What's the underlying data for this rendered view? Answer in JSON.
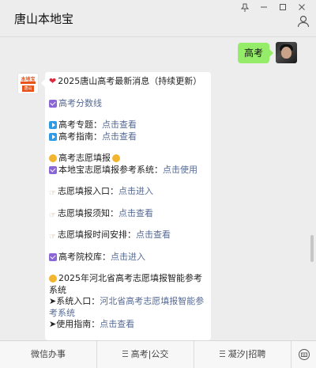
{
  "window": {
    "title": "唐山本地宝",
    "controls": {
      "pin": "⊥",
      "minimize": "–",
      "maximize": "□",
      "close": "✕"
    }
  },
  "outgoing": {
    "text": "高考"
  },
  "bot": {
    "avatar_text_top": "本地宝",
    "avatar_text_bottom": "唐山",
    "lines": [
      {
        "icon": "heart-icon",
        "text": "2025唐山高考最新消息（持续更新）"
      },
      {
        "icon": "check-icon",
        "link": "高考分数线"
      },
      {
        "icon": "play-icon",
        "prefix": "高考专题：",
        "link": "点击查看"
      },
      {
        "icon": "play-icon",
        "prefix": "高考指南：",
        "link": "点击查看"
      },
      {
        "icon": "dot-icon",
        "text": "高考志愿填报",
        "trail_icon": "dot-icon"
      },
      {
        "icon": "check-icon",
        "prefix": "本地宝志愿填报参考系统：",
        "link": "点击使用"
      },
      {
        "icon": "hand-icon",
        "prefix": "志愿填报入口：",
        "link": "点击进入"
      },
      {
        "icon": "hand-icon",
        "prefix": "志愿填报须知：",
        "link": "点击查看"
      },
      {
        "icon": "hand-icon",
        "prefix": "志愿填报时间安排：",
        "link": "点击查看"
      },
      {
        "icon": "check-icon",
        "prefix": "高考院校库：",
        "link": "点击进入"
      },
      {
        "icon": "dot-icon",
        "text": "2025年河北省高考志愿填报智能参考系统"
      },
      {
        "icon": "arrow-icon",
        "prefix": "➤系统入口：",
        "link": "河北省高考志愿填报智能参考系统"
      },
      {
        "icon": "arrow-icon",
        "prefix": "➤使用指南：",
        "link": "点击查看"
      }
    ]
  },
  "menu": {
    "items": [
      "微信办事",
      "高考|公交",
      "凝汐|招聘"
    ]
  }
}
